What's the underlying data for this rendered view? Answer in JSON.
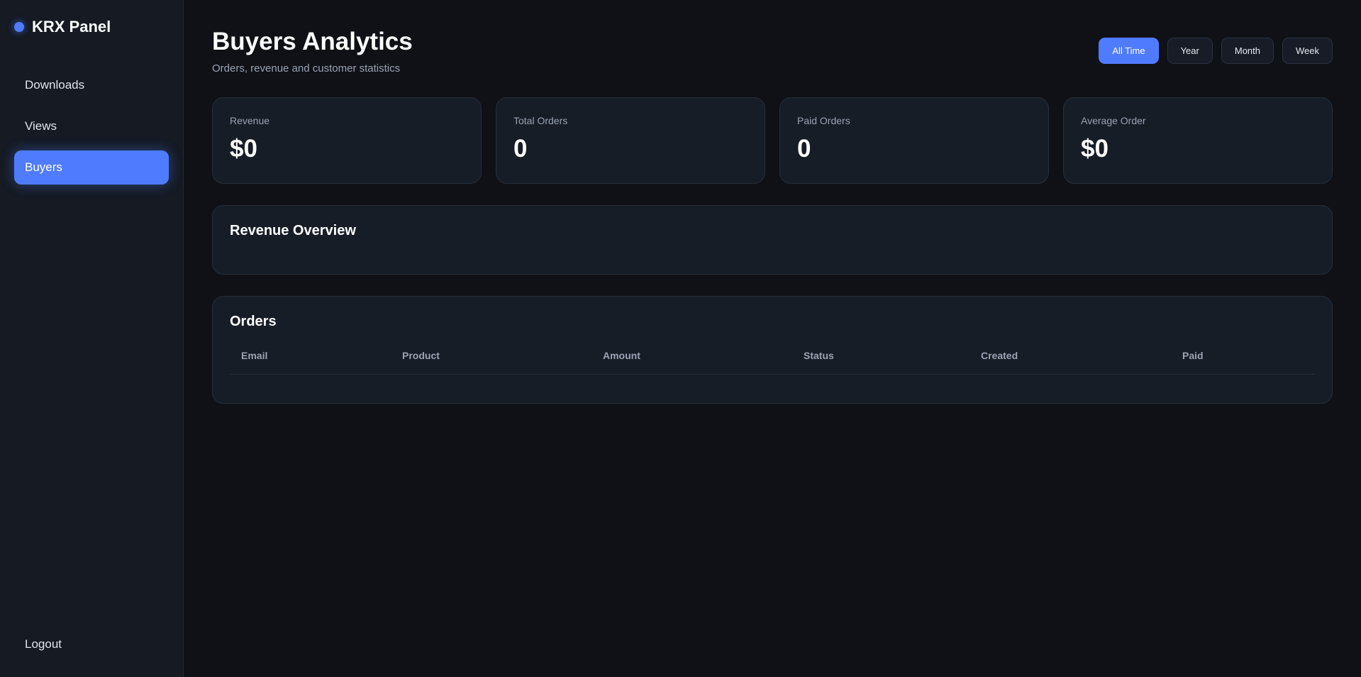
{
  "sidebar": {
    "brand": "KRX Panel",
    "items": [
      {
        "label": "Downloads"
      },
      {
        "label": "Views"
      },
      {
        "label": "Buyers"
      }
    ],
    "logout": "Logout"
  },
  "header": {
    "title": "Buyers Analytics",
    "subtitle": "Orders, revenue and customer statistics",
    "periods": [
      "All Time",
      "Year",
      "Month",
      "Week"
    ],
    "selected_period": "All Time"
  },
  "stats": [
    {
      "label": "Revenue",
      "value": "$0"
    },
    {
      "label": "Total Orders",
      "value": "0"
    },
    {
      "label": "Paid Orders",
      "value": "0"
    },
    {
      "label": "Average Order",
      "value": "$0"
    }
  ],
  "revenue_overview": {
    "title": "Revenue Overview"
  },
  "orders": {
    "title": "Orders",
    "columns": [
      "Email",
      "Product",
      "Amount",
      "Status",
      "Created",
      "Paid"
    ],
    "rows": []
  },
  "colors": {
    "accent": "#4f7cff",
    "background": "#0f1117",
    "sidebar": "#151a23",
    "card": "#171d27"
  }
}
